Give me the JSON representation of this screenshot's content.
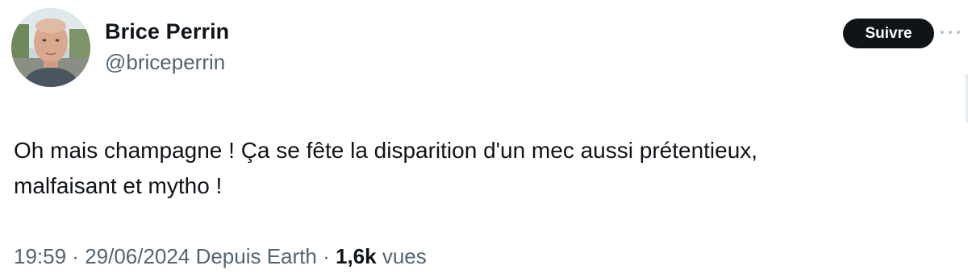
{
  "author": {
    "display_name": "Brice Perrin",
    "handle": "@briceperrin",
    "avatar_icon": "profile-photo"
  },
  "follow_label": "Suivre",
  "more_icon": "ellipsis-horizontal-icon",
  "tweet": {
    "text": "Oh mais champagne ! Ça se fête la disparition d'un mec aussi prétentieux,\nmalfaisant et mytho !"
  },
  "meta": {
    "time": "19:59",
    "sep1": " · ",
    "date": "29/06/2024",
    "source": "Depuis Earth",
    "sep2": " · ",
    "views_count": "1,6k",
    "views_label": "vues"
  },
  "colors": {
    "text": "#0f1419",
    "secondary": "#536471",
    "button_bg": "#0f1419",
    "button_text": "#ffffff"
  }
}
